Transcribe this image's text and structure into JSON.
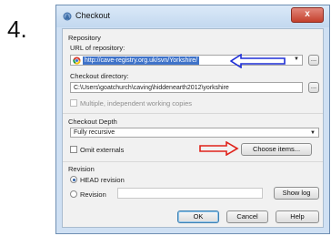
{
  "step_number": "4.",
  "window": {
    "title": "Checkout",
    "close_glyph": "x"
  },
  "repository": {
    "group_label": "Repository",
    "url_label": "URL of repository:",
    "url_value": "http://cave-registry.org.uk/svn/Yorkshire/",
    "browse_label": "...",
    "checkout_dir_label": "Checkout directory:",
    "checkout_dir_value": "C:\\Users\\goatchurch\\caving\\hiddenearth2012\\yorkshire",
    "checkout_browse_label": "...",
    "multiple_label": "Multiple, independent working copies"
  },
  "depth": {
    "group_label": "Checkout Depth",
    "value": "Fully recursive",
    "omit_externals_label": "Omit externals",
    "choose_items_label": "Choose items..."
  },
  "revision": {
    "group_label": "Revision",
    "head_label": "HEAD revision",
    "revision_label": "Revision",
    "show_log_label": "Show log"
  },
  "buttons": {
    "ok": "OK",
    "cancel": "Cancel",
    "help": "Help"
  },
  "colors": {
    "annotation_arrow_blue": "#1f2fd6",
    "annotation_arrow_red": "#e0221a"
  }
}
